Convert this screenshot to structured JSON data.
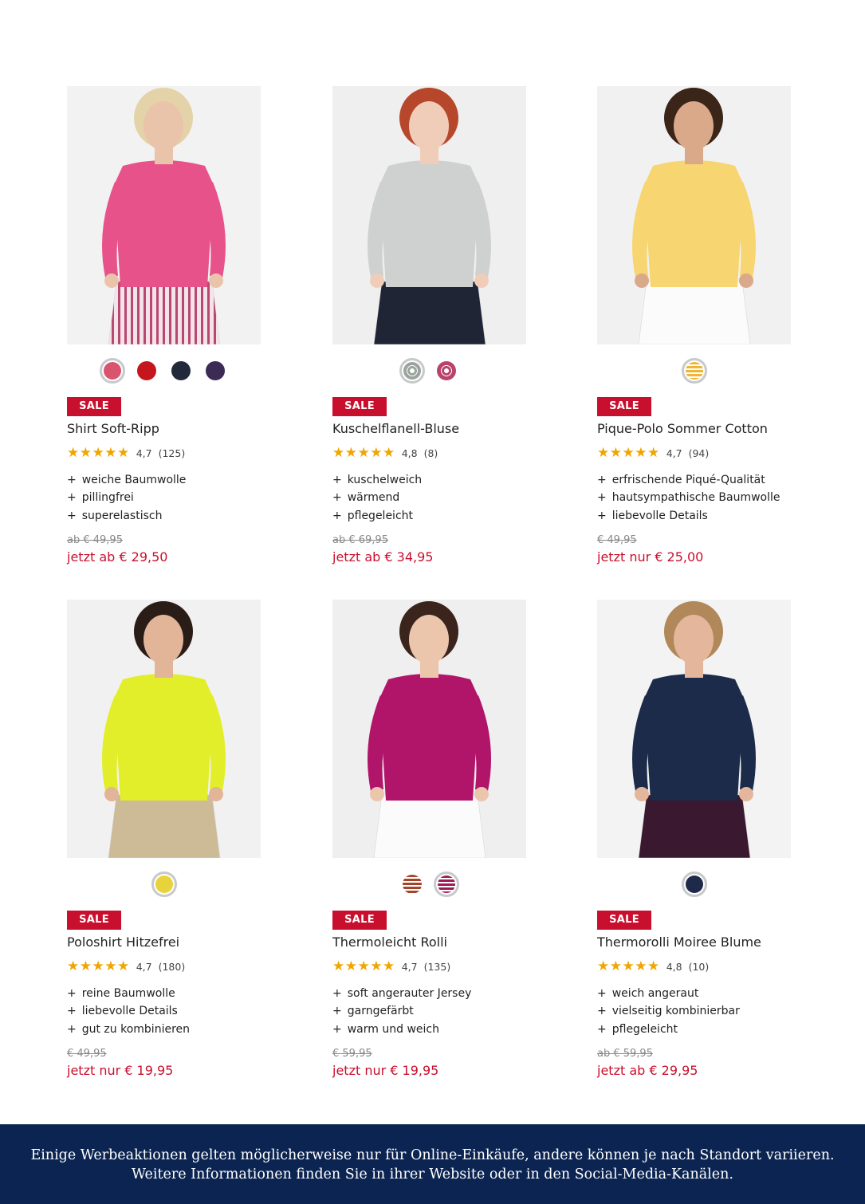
{
  "products": [
    {
      "badge": "SALE",
      "name": "Shirt Soft-Ripp",
      "stars": "★★★★★",
      "rating": "4,7",
      "reviews": "(125)",
      "features": [
        "weiche Baumwolle",
        "pillingfrei",
        "superelastisch"
      ],
      "old_price": "ab € 49,95",
      "new_price": "jetzt ab € 29,50",
      "swatch_colors": [
        "#d9546e",
        "#c5161d",
        "#23283a",
        "#3c2b55"
      ],
      "photo": {
        "bg": "#f2f2f2",
        "top_color": "#e8528a",
        "skin": "#e9c4aa",
        "hair": "#e4d3a8",
        "bottom": "stripes"
      }
    },
    {
      "badge": "SALE",
      "name": "Kuschelflanell-Bluse",
      "stars": "★★★★★",
      "rating": "4,8",
      "reviews": "(8)",
      "features": [
        "kuschelweich",
        "wärmend",
        "pflegeleicht"
      ],
      "old_price": "ab € 69,95",
      "new_price": "jetzt ab € 34,95",
      "swatch_colors": [
        "#9aa39c",
        "#b8446d"
      ],
      "photo": {
        "bg": "#efefef",
        "top_color": "#cfd1d0",
        "skin": "#f0cdb8",
        "hair": "#b6472a",
        "bottom": "navy"
      }
    },
    {
      "badge": "SALE",
      "name": "Pique-Polo Sommer Cotton",
      "stars": "★★★★★",
      "rating": "4,7",
      "reviews": "(94)",
      "features": [
        "erfrischende Piqué-Qualität",
        "hautsympathische Baumwolle",
        "liebevolle Details"
      ],
      "old_price": "€ 49,95",
      "new_price": "jetzt nur € 25,00",
      "swatch_colors": [
        "#f0b436"
      ],
      "photo": {
        "bg": "#f1f1f1",
        "top_color": "#f7d570",
        "skin": "#d9a98a",
        "hair": "#3b2418",
        "bottom": "white"
      }
    },
    {
      "badge": "SALE",
      "name": "Poloshirt Hitzefrei",
      "stars": "★★★★★",
      "rating": "4,7",
      "reviews": "(180)",
      "features": [
        "reine Baumwolle",
        "liebevolle Details",
        "gut zu kombinieren"
      ],
      "old_price": "€ 49,95",
      "new_price": "jetzt nur € 19,95",
      "swatch_colors": [
        "#e8d43a"
      ],
      "photo": {
        "bg": "#f1f1f1",
        "top_color": "#e3ee2a",
        "skin": "#e2b498",
        "hair": "#2a1d17",
        "bottom": "beige"
      }
    },
    {
      "badge": "SALE",
      "name": "Thermoleicht Rolli",
      "stars": "★★★★★",
      "rating": "4,7",
      "reviews": "(135)",
      "features": [
        "soft angerauter Jersey",
        "garngefärbt",
        "warm und weich"
      ],
      "old_price": "€ 59,95",
      "new_price": "jetzt nur € 19,95",
      "swatch_colors": [
        "#a3452a",
        "#a21a55"
      ],
      "photo": {
        "bg": "#efefef",
        "top_color": "#b0156a",
        "skin": "#ecc5ad",
        "hair": "#3a241c",
        "bottom": "white"
      }
    },
    {
      "badge": "SALE",
      "name": "Thermorolli Moiree Blume",
      "stars": "★★★★★",
      "rating": "4,8",
      "reviews": "(10)",
      "features": [
        "weich angeraut",
        "vielseitig kombinierbar",
        "pflegeleicht"
      ],
      "old_price": "ab € 59,95",
      "new_price": "jetzt ab € 29,95",
      "swatch_colors": [
        "#1f2a4a"
      ],
      "photo": {
        "bg": "#f3f3f3",
        "top_color": "#1c2b4a",
        "skin": "#e4b79c",
        "hair": "#b0885a",
        "bottom": "plum"
      }
    }
  ],
  "footer": {
    "line1": "Einige Werbeaktionen gelten möglicherweise nur für Online-Einkäufe, andere können je nach Standort variieren.",
    "line2": "Weitere Informationen finden Sie in ihrer Website oder in den Social-Media-Kanälen."
  }
}
